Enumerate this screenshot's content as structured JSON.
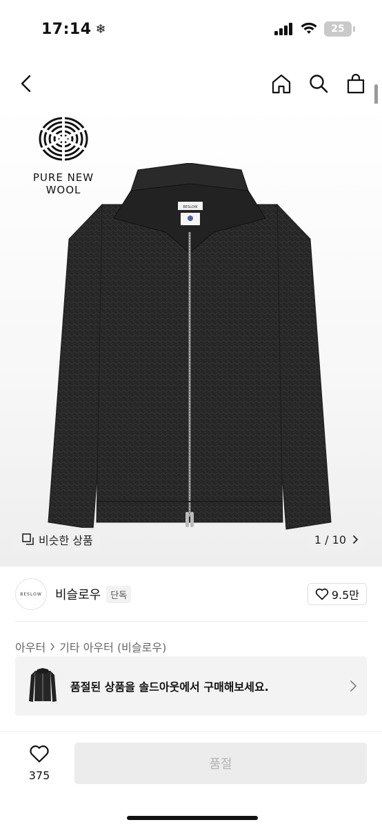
{
  "status_bar": {
    "time": "17:14",
    "battery": "25"
  },
  "hero": {
    "badge_text": "PURE NEW WOOL",
    "garment_label": "BESLOW",
    "similar_label": "비슷한 상품",
    "pager": "1 / 10"
  },
  "brand": {
    "avatar_text": "BESLOW",
    "name": "비슬로우",
    "tag": "단독",
    "likes": "9.5만"
  },
  "breadcrumb": {
    "level1": "아우터",
    "level2": "기타 아우터 (비슬로우)"
  },
  "banner": {
    "text": "품절된 상품을 솔드아웃에서 구매해보세요."
  },
  "bottom_bar": {
    "wish_count": "375",
    "button_label": "품절"
  },
  "colors": {
    "accent_gray": "#ececec",
    "text_primary": "#111111"
  }
}
